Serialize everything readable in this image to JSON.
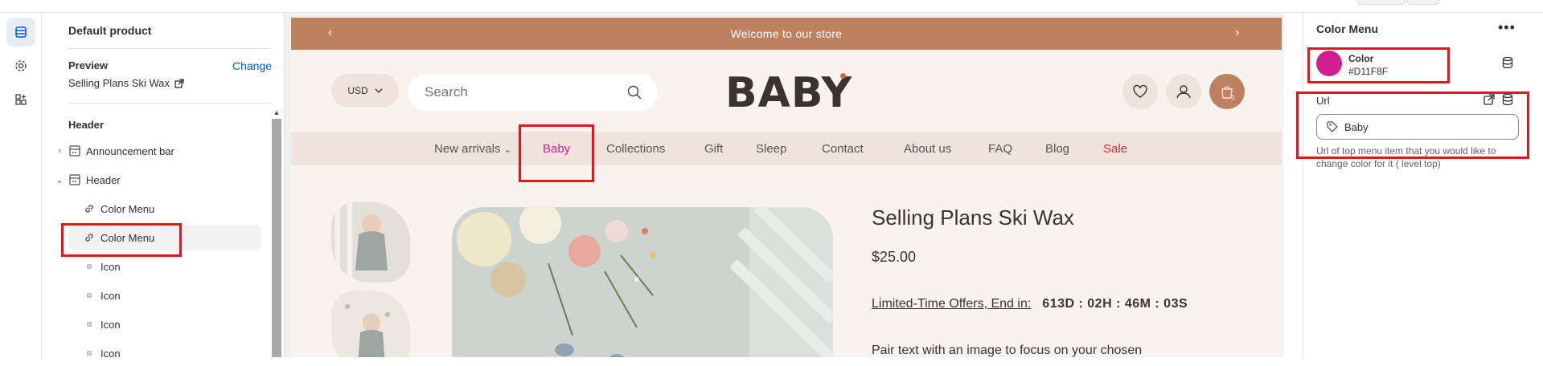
{
  "left_panel": {
    "title": "Default product",
    "preview_label": "Preview",
    "change_label": "Change",
    "preview_value": "Selling Plans Ski Wax",
    "section_label": "Header",
    "tree": [
      {
        "label": "Announcement bar",
        "icon": "section-icon",
        "expandable": true
      },
      {
        "label": "Header",
        "icon": "section-icon",
        "expandable": true
      },
      {
        "label": "Color Menu",
        "icon": "link-icon"
      },
      {
        "label": "Color Menu",
        "icon": "link-icon"
      },
      {
        "label": "Icon",
        "icon": "block-icon"
      },
      {
        "label": "Icon",
        "icon": "block-icon"
      },
      {
        "label": "Icon",
        "icon": "block-icon"
      },
      {
        "label": "Icon",
        "icon": "block-icon"
      }
    ]
  },
  "store": {
    "announcement": "Welcome to our store",
    "currency": "USD",
    "search_placeholder": "Search",
    "logo": "BABY",
    "cart_count": "1",
    "nav": [
      "New arrivals",
      "Baby",
      "Collections",
      "Gift",
      "Sleep",
      "Contact",
      "About us",
      "FAQ",
      "Blog",
      "Sale"
    ],
    "nav_colors": {
      "active": "#D11F8F",
      "sale": "#d0312d",
      "default": "#555555"
    },
    "product": {
      "title": "Selling Plans Ski Wax",
      "price": "$25.00",
      "offer_label": "Limited-Time Offers, End in:",
      "offer_timer": "613D : 02H : 46M : 03S",
      "description": "Pair text with an image to focus on your chosen"
    }
  },
  "right_panel": {
    "title": "Color Menu",
    "color_label": "Color",
    "color_value": "#D11F8F",
    "url_label": "Url",
    "url_value": "Baby",
    "url_help": "Url of top menu item that you would like to change color for it ( level top)"
  }
}
